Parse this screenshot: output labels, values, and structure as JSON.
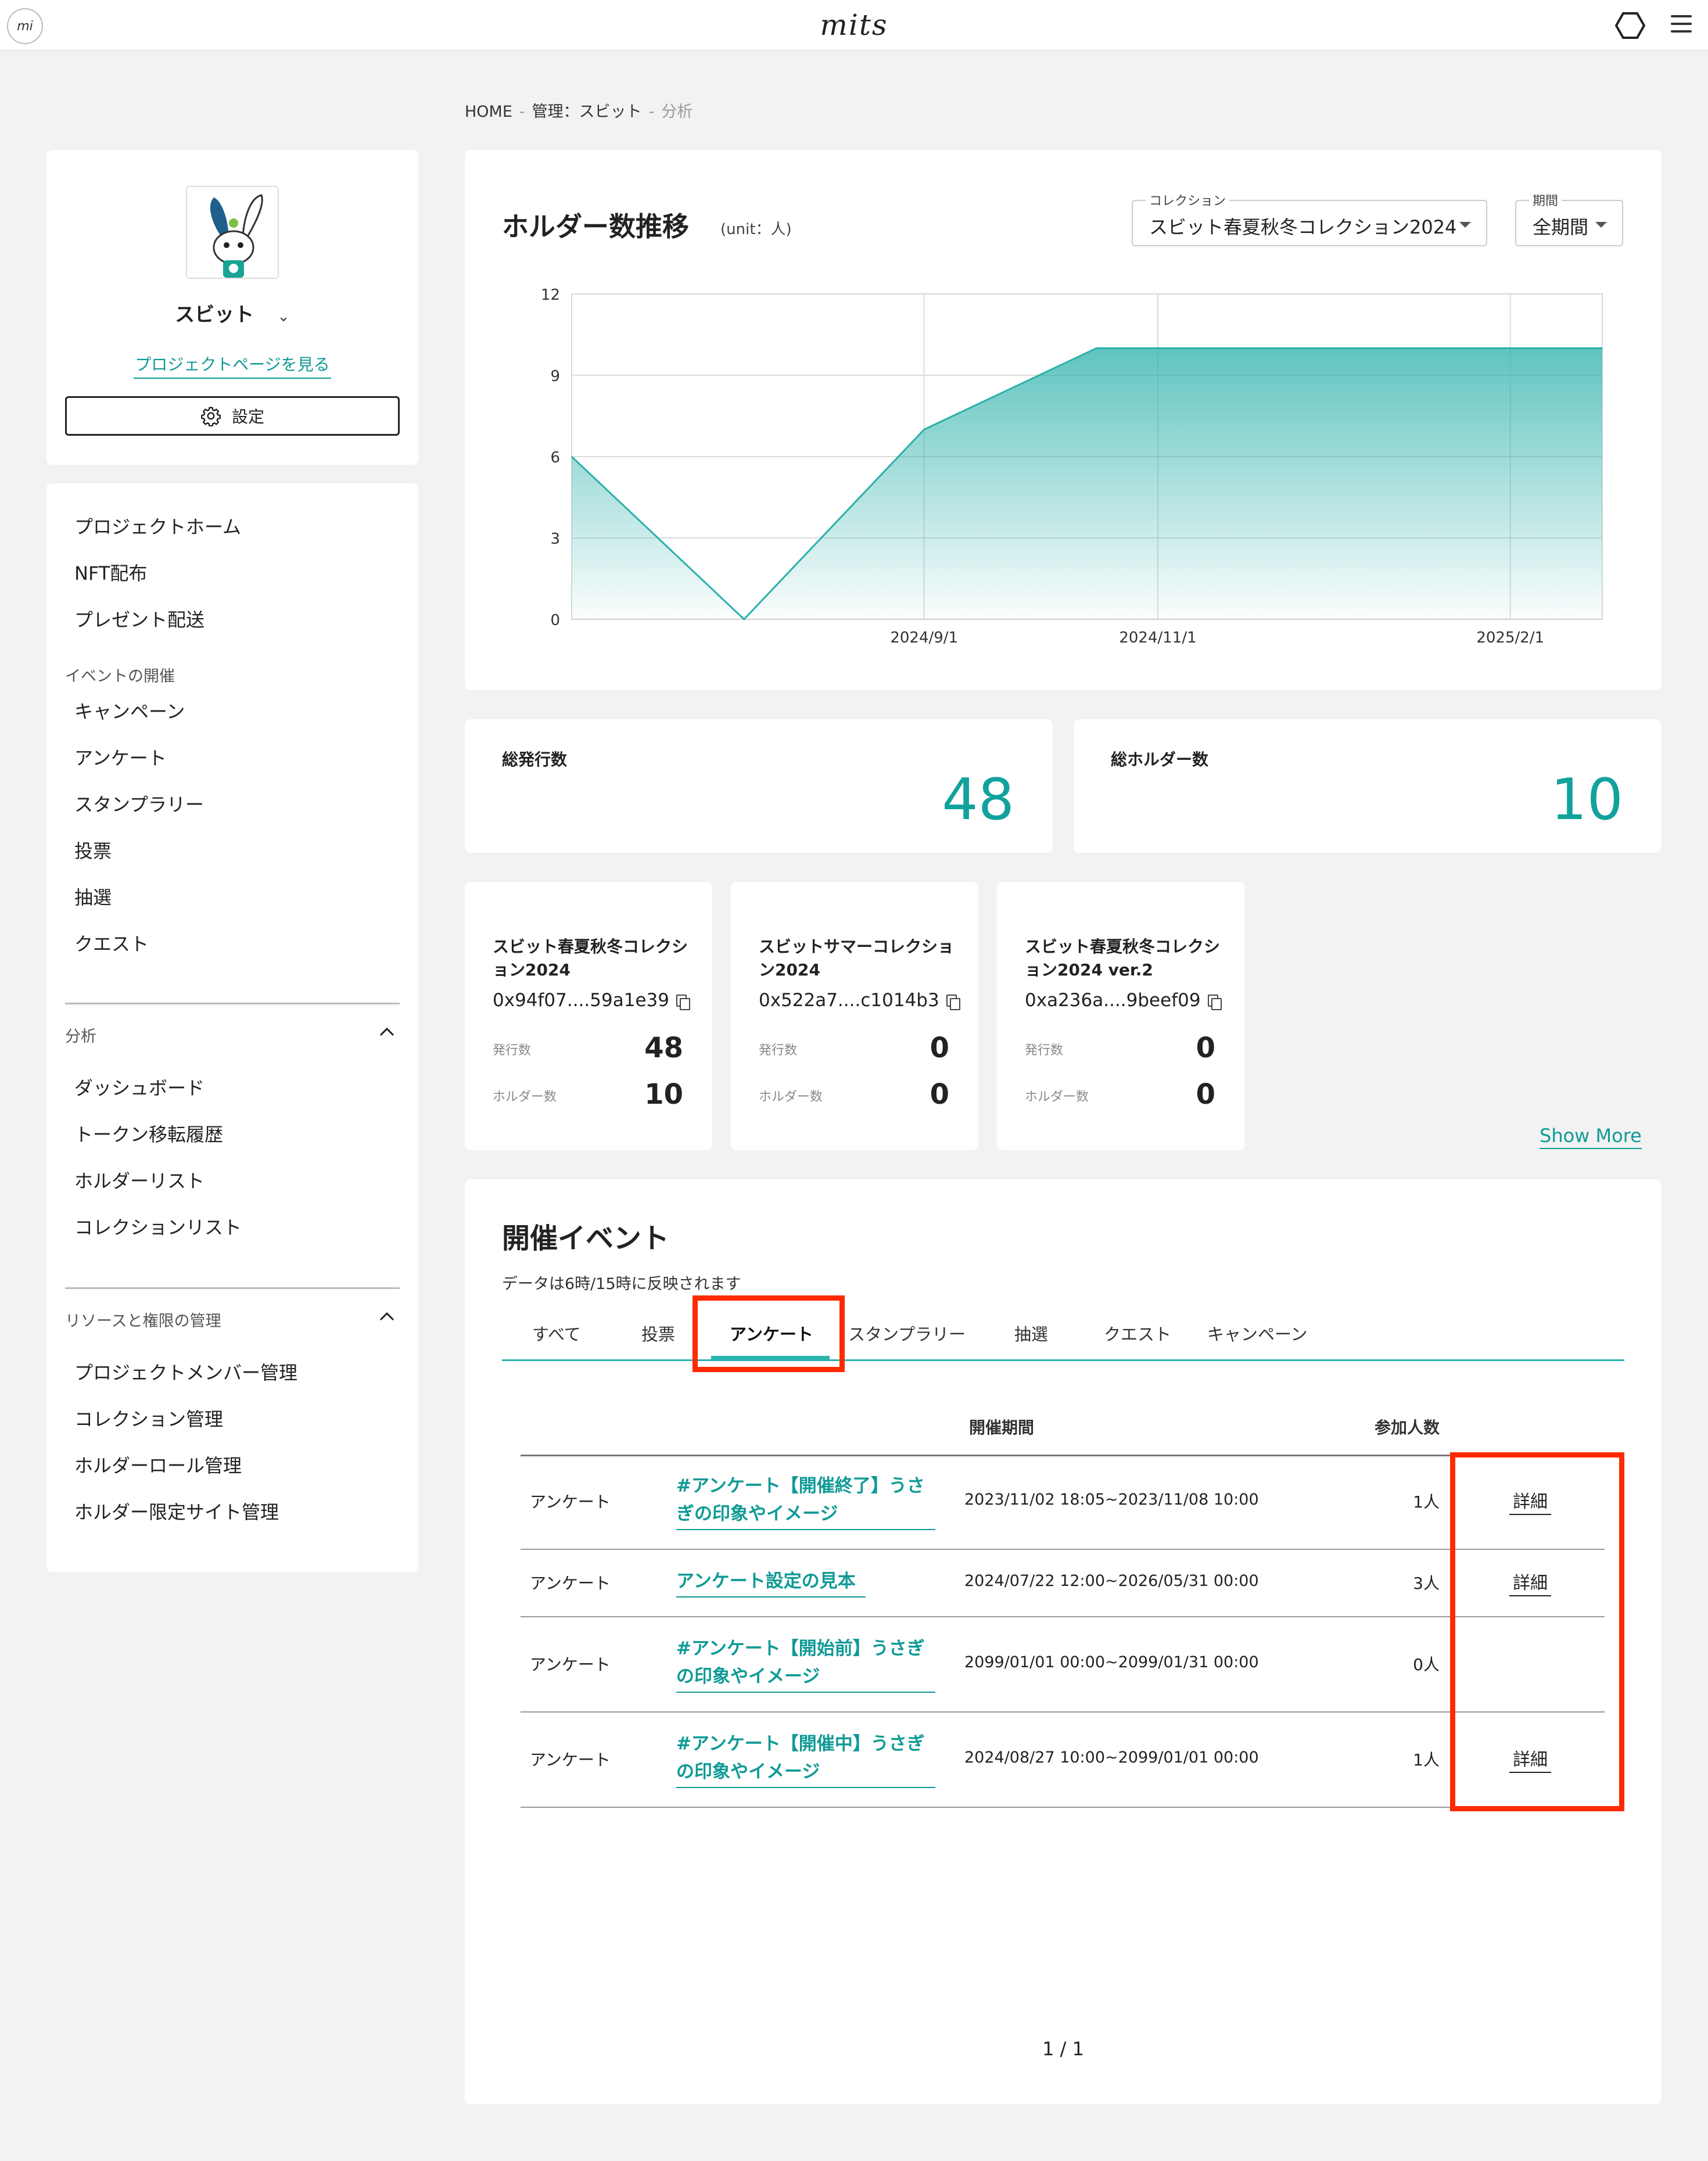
{
  "app": {
    "brand": "mits",
    "logo_text": "mi"
  },
  "breadcrumb": [
    "HOME",
    "管理：スビット",
    "分析"
  ],
  "project": {
    "name": "スビット",
    "link_label": "プロジェクトページを見る",
    "settings_label": "設定"
  },
  "nav": {
    "main": [
      "プロジェクトホーム",
      "NFT配布",
      "プレゼント配送"
    ],
    "events_section": "イベントの開催",
    "events": [
      "キャンペーン",
      "アンケート",
      "スタンプラリー",
      "投票",
      "抽選",
      "クエスト"
    ],
    "analysis_section": "分析",
    "analysis": [
      "ダッシュボード",
      "トークン移転履歴",
      "ホルダーリスト",
      "コレクションリスト"
    ],
    "resources_section": "リソースと権限の管理",
    "resources": [
      "プロジェクトメンバー管理",
      "コレクション管理",
      "ホルダーロール管理",
      "ホルダー限定サイト管理"
    ]
  },
  "chart_header": {
    "title": "ホルダー数推移",
    "unit": "(unit：人)",
    "collection_label": "コレクション",
    "collection_value": "スビット春夏秋冬コレクション2024",
    "period_label": "期間",
    "period_value": "全期間"
  },
  "chart_data": {
    "type": "area",
    "x": [
      "2024/6/1",
      "2024/7/16",
      "2024/9/1",
      "2024/10/16",
      "2025/2/25"
    ],
    "values": [
      6,
      0,
      7,
      10,
      10
    ],
    "x_tick_labels": [
      "2024/9/1",
      "2024/11/1",
      "2025/2/1"
    ],
    "y_ticks": [
      0,
      3,
      6,
      9,
      12
    ],
    "ylim": [
      0,
      12
    ],
    "grid": true,
    "color": "#2ab0aa"
  },
  "stats": {
    "total_issued_label": "総発行数",
    "total_issued": "48",
    "total_holders_label": "総ホルダー数",
    "total_holders": "10"
  },
  "collections": [
    {
      "name": "スビット春夏秋冬コレクション2024",
      "address": "0x94f07....59a1e39",
      "issued_label": "発行数",
      "issued": "48",
      "holders_label": "ホルダー数",
      "holders": "10"
    },
    {
      "name": "スビットサマーコレクション2024",
      "address": "0x522a7....c1014b3",
      "issued_label": "発行数",
      "issued": "0",
      "holders_label": "ホルダー数",
      "holders": "0"
    },
    {
      "name": "スビット春夏秋冬コレクション2024 ver.2",
      "address": "0xa236a....9beef09",
      "issued_label": "発行数",
      "issued": "0",
      "holders_label": "ホルダー数",
      "holders": "0"
    }
  ],
  "show_more": "Show More",
  "events": {
    "title": "開催イベント",
    "note": "データは6時/15時に反映されます",
    "tabs": [
      "すべて",
      "投票",
      "アンケート",
      "スタンプラリー",
      "抽選",
      "クエスト",
      "キャンペーン"
    ],
    "active_tab": "アンケート",
    "columns": {
      "period": "開催期間",
      "participants": "参加人数"
    },
    "rows": [
      {
        "type": "アンケート",
        "name": "#アンケート【開催終了】うさぎの印象やイメージ",
        "period": "2023/11/02 18:05~2023/11/08 10:00",
        "count": "1人",
        "detail": "詳細"
      },
      {
        "type": "アンケート",
        "name": "アンケート設定の見本",
        "period": "2024/07/22 12:00~2026/05/31 00:00",
        "count": "3人",
        "detail": "詳細"
      },
      {
        "type": "アンケート",
        "name": "#アンケート【開始前】うさぎの印象やイメージ",
        "period": "2099/01/01 00:00~2099/01/31 00:00",
        "count": "0人",
        "detail": ""
      },
      {
        "type": "アンケート",
        "name": "#アンケート【開催中】うさぎの印象やイメージ",
        "period": "2024/08/27 10:00~2099/01/01 00:00",
        "count": "1人",
        "detail": "詳細"
      }
    ],
    "pager": "1 / 1"
  }
}
